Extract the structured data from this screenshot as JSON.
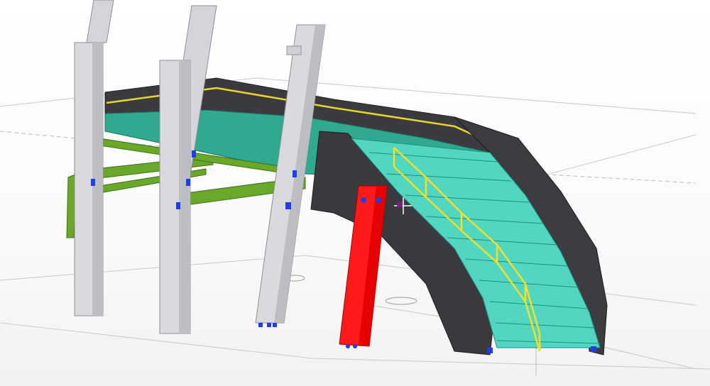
{
  "viewport": {
    "label": "",
    "background": "#ffffff"
  },
  "colors": {
    "steel_gray": "#cfcfd4",
    "steel_gray_dark": "#a9a9b0",
    "concrete_dark": "#3b3b3f",
    "concrete_darker": "#2a2a2d",
    "slab_teal": "#34b8a0",
    "stair_teal": "#52d6c0",
    "beam_green": "#6aa82a",
    "beam_green_dark": "#4f8a1d",
    "railing_yellow": "#f0e02a",
    "selected_red": "#ff1a1a",
    "bolt_blue": "#1f3fe6",
    "grid_line": "#c8c8c8",
    "cursor_purple": "#7a1f8a"
  },
  "scene": {
    "columns": [
      {
        "name": "column-left-front"
      },
      {
        "name": "column-left-back"
      },
      {
        "name": "column-middle-front"
      },
      {
        "name": "column-middle-back"
      },
      {
        "name": "column-right"
      }
    ],
    "selected_member": {
      "name": "selected-column-red"
    },
    "stair": {
      "name": "stair-flight"
    },
    "platform": {
      "name": "platform-slab"
    },
    "cursor": {
      "name": "crosshair-cursor-icon"
    }
  }
}
